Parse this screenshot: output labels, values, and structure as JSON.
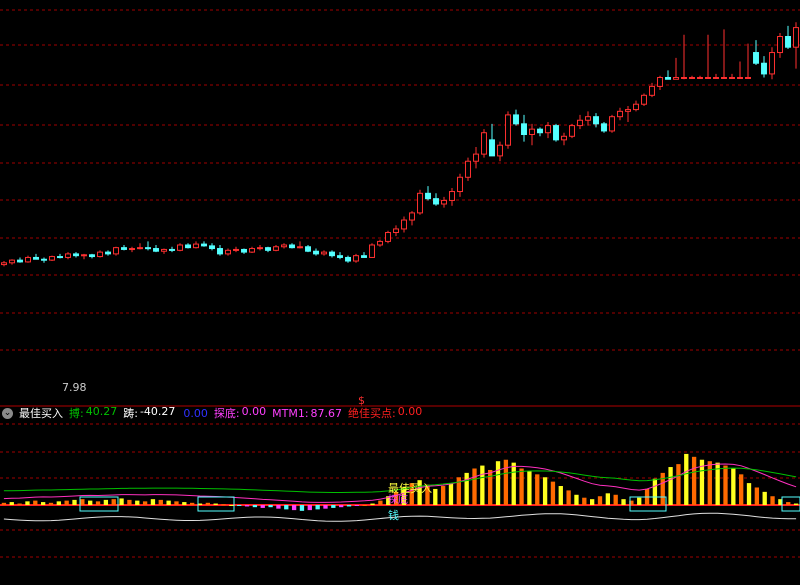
{
  "indicator_bar": {
    "name": "最佳买入",
    "items": [
      {
        "label": "搏:",
        "value": "40.27",
        "color": "#00c000"
      },
      {
        "label": "踌:",
        "value": "-40.27",
        "color": "#ffffff"
      },
      {
        "label": "",
        "value": "0.00",
        "color": "#3030ff"
      },
      {
        "label": "探底:",
        "value": "0.00",
        "color": "#ff40ff"
      },
      {
        "label": "MTM1:",
        "value": "87.67",
        "color": "#ff40ff"
      },
      {
        "label": "绝佳买点:",
        "value": "0.00",
        "color": "#ff2020"
      }
    ]
  },
  "chart_data": [
    {
      "type": "candlestick",
      "title": "",
      "price_label": "7.98",
      "ylim": [
        0,
        22
      ],
      "marker_text": "$",
      "candles": [
        [
          1,
          7.6,
          7.8,
          7.5,
          7.7
        ],
        [
          2,
          7.7,
          7.9,
          7.6,
          7.85
        ],
        [
          3,
          7.85,
          8.0,
          7.7,
          7.75
        ],
        [
          4,
          7.75,
          8.1,
          7.7,
          8.0
        ],
        [
          5,
          8.0,
          8.2,
          7.9,
          7.9
        ],
        [
          6,
          7.9,
          8.0,
          7.7,
          7.85
        ],
        [
          7,
          7.85,
          8.1,
          7.8,
          8.05
        ],
        [
          8,
          8.05,
          8.2,
          7.95,
          8.0
        ],
        [
          9,
          8.0,
          8.3,
          7.9,
          8.2
        ],
        [
          10,
          8.2,
          8.3,
          8.0,
          8.1
        ],
        [
          11,
          8.1,
          8.2,
          7.9,
          8.15
        ],
        [
          12,
          8.15,
          8.2,
          7.95,
          8.05
        ],
        [
          13,
          8.05,
          8.4,
          8.0,
          8.3
        ],
        [
          14,
          8.3,
          8.4,
          8.1,
          8.2
        ],
        [
          15,
          8.2,
          8.6,
          8.1,
          8.55
        ],
        [
          16,
          8.55,
          8.7,
          8.4,
          8.45
        ],
        [
          17,
          8.45,
          8.6,
          8.3,
          8.5
        ],
        [
          18,
          8.5,
          8.8,
          8.45,
          8.55
        ],
        [
          19,
          8.55,
          8.9,
          8.4,
          8.5
        ],
        [
          20,
          8.5,
          8.7,
          8.3,
          8.35
        ],
        [
          21,
          8.35,
          8.5,
          8.2,
          8.45
        ],
        [
          22,
          8.45,
          8.6,
          8.3,
          8.4
        ],
        [
          23,
          8.4,
          8.8,
          8.35,
          8.7
        ],
        [
          24,
          8.7,
          8.8,
          8.5,
          8.55
        ],
        [
          25,
          8.55,
          8.9,
          8.5,
          8.75
        ],
        [
          26,
          8.75,
          8.9,
          8.6,
          8.65
        ],
        [
          27,
          8.65,
          8.8,
          8.4,
          8.5
        ],
        [
          28,
          8.5,
          8.7,
          8.1,
          8.2
        ],
        [
          29,
          8.2,
          8.5,
          8.1,
          8.4
        ],
        [
          30,
          8.4,
          8.6,
          8.3,
          8.45
        ],
        [
          31,
          8.45,
          8.5,
          8.2,
          8.3
        ],
        [
          32,
          8.3,
          8.6,
          8.25,
          8.5
        ],
        [
          33,
          8.5,
          8.7,
          8.4,
          8.55
        ],
        [
          34,
          8.55,
          8.6,
          8.3,
          8.4
        ],
        [
          35,
          8.4,
          8.7,
          8.35,
          8.6
        ],
        [
          36,
          8.6,
          8.8,
          8.5,
          8.7
        ],
        [
          37,
          8.7,
          8.8,
          8.5,
          8.55
        ],
        [
          38,
          8.55,
          8.9,
          8.5,
          8.6
        ],
        [
          39,
          8.6,
          8.7,
          8.3,
          8.35
        ],
        [
          40,
          8.35,
          8.5,
          8.1,
          8.2
        ],
        [
          41,
          8.2,
          8.4,
          8.1,
          8.3
        ],
        [
          42,
          8.3,
          8.4,
          8.0,
          8.1
        ],
        [
          43,
          8.1,
          8.3,
          7.9,
          8.0
        ],
        [
          44,
          8.0,
          8.1,
          7.7,
          7.8
        ],
        [
          45,
          7.8,
          8.2,
          7.7,
          8.1
        ],
        [
          46,
          8.1,
          8.3,
          7.98,
          8.0
        ],
        [
          47,
          8.0,
          8.8,
          7.98,
          8.7
        ],
        [
          48,
          8.7,
          9.0,
          8.6,
          8.9
        ],
        [
          49,
          8.9,
          9.5,
          8.8,
          9.4
        ],
        [
          50,
          9.4,
          9.8,
          9.2,
          9.6
        ],
        [
          51,
          9.6,
          10.3,
          9.4,
          10.1
        ],
        [
          52,
          10.1,
          10.6,
          9.8,
          10.5
        ],
        [
          53,
          10.5,
          11.8,
          10.4,
          11.6
        ],
        [
          54,
          11.6,
          12.0,
          11.2,
          11.3
        ],
        [
          55,
          11.3,
          11.6,
          10.9,
          11.0
        ],
        [
          56,
          11.0,
          11.4,
          10.8,
          11.2
        ],
        [
          57,
          11.2,
          11.9,
          10.9,
          11.7
        ],
        [
          58,
          11.7,
          12.7,
          11.4,
          12.5
        ],
        [
          59,
          12.5,
          13.6,
          12.3,
          13.4
        ],
        [
          60,
          13.4,
          14.2,
          13.0,
          13.8
        ],
        [
          61,
          13.8,
          15.2,
          13.6,
          15.0
        ],
        [
          62,
          14.6,
          15.5,
          13.7,
          13.7
        ],
        [
          63,
          13.7,
          14.5,
          13.4,
          14.3
        ],
        [
          64,
          14.3,
          16.2,
          14.1,
          16.0
        ],
        [
          65,
          16.0,
          16.3,
          15.4,
          15.5
        ],
        [
          66,
          15.5,
          16.0,
          14.5,
          14.9
        ],
        [
          67,
          14.9,
          15.5,
          14.3,
          15.2
        ],
        [
          68,
          15.2,
          15.3,
          14.8,
          15.0
        ],
        [
          69,
          15.0,
          15.6,
          14.7,
          15.4
        ],
        [
          70,
          15.4,
          15.5,
          14.5,
          14.6
        ],
        [
          71,
          14.6,
          15.0,
          14.3,
          14.8
        ],
        [
          72,
          14.8,
          15.5,
          14.7,
          15.4
        ],
        [
          73,
          15.4,
          16.0,
          15.2,
          15.7
        ],
        [
          74,
          15.7,
          16.2,
          15.4,
          15.9
        ],
        [
          75,
          15.9,
          16.1,
          15.3,
          15.5
        ],
        [
          76,
          15.5,
          15.6,
          15.0,
          15.1
        ],
        [
          77,
          15.1,
          16.0,
          15.0,
          15.9
        ],
        [
          78,
          15.9,
          16.4,
          15.7,
          16.2
        ],
        [
          79,
          16.2,
          16.5,
          15.6,
          16.3
        ],
        [
          80,
          16.3,
          16.8,
          16.2,
          16.6
        ],
        [
          81,
          16.6,
          17.2,
          16.5,
          17.1
        ],
        [
          82,
          17.1,
          17.8,
          17.0,
          17.6
        ],
        [
          83,
          17.6,
          18.2,
          17.4,
          18.1
        ],
        [
          84,
          18.1,
          18.5,
          18.0,
          18.0
        ],
        [
          85,
          18.0,
          19.2,
          18.0,
          18.1
        ],
        [
          86,
          18.1,
          20.5,
          18.0,
          18.1
        ],
        [
          87,
          18.1,
          18.2,
          18.1,
          18.1
        ],
        [
          88,
          18.1,
          18.2,
          18.1,
          18.1
        ],
        [
          89,
          18.1,
          20.5,
          18.1,
          18.1
        ],
        [
          90,
          18.1,
          18.3,
          18.1,
          18.1
        ],
        [
          91,
          18.1,
          20.8,
          18.1,
          18.1
        ],
        [
          92,
          18.1,
          18.3,
          18.1,
          18.1
        ],
        [
          93,
          18.1,
          19.0,
          18.1,
          18.1
        ],
        [
          94,
          18.1,
          20.0,
          18.1,
          18.1
        ],
        [
          95,
          19.5,
          20.2,
          18.8,
          18.9
        ],
        [
          96,
          18.9,
          19.3,
          18.1,
          18.3
        ],
        [
          97,
          18.3,
          19.8,
          18.0,
          19.5
        ],
        [
          98,
          19.5,
          20.6,
          19.2,
          20.4
        ],
        [
          99,
          20.4,
          21.0,
          19.7,
          19.8
        ],
        [
          100,
          19.8,
          21.2,
          18.6,
          20.9
        ]
      ]
    },
    {
      "type": "bar",
      "title": "",
      "labels": [
        "最佳买入",
        "探底",
        "钱"
      ],
      "ylim": [
        -10,
        100
      ],
      "values": [
        3,
        4,
        2,
        5,
        6,
        4,
        3,
        5,
        6,
        7,
        8,
        6,
        5,
        7,
        8,
        9,
        7,
        6,
        5,
        8,
        7,
        6,
        5,
        4,
        3,
        2,
        3,
        2,
        1,
        0,
        -1,
        -2,
        -3,
        -4,
        -3,
        -5,
        -6,
        -7,
        -8,
        -7,
        -6,
        -5,
        -4,
        -3,
        -2,
        -1,
        0,
        2,
        6,
        12,
        18,
        24,
        30,
        34,
        28,
        22,
        26,
        30,
        38,
        44,
        50,
        54,
        48,
        60,
        62,
        58,
        50,
        46,
        42,
        38,
        32,
        26,
        20,
        14,
        10,
        8,
        12,
        16,
        14,
        8,
        6,
        10,
        22,
        36,
        44,
        52,
        56,
        70,
        66,
        62,
        60,
        58,
        54,
        50,
        42,
        30,
        24,
        18,
        12,
        8,
        4,
        2
      ]
    }
  ]
}
